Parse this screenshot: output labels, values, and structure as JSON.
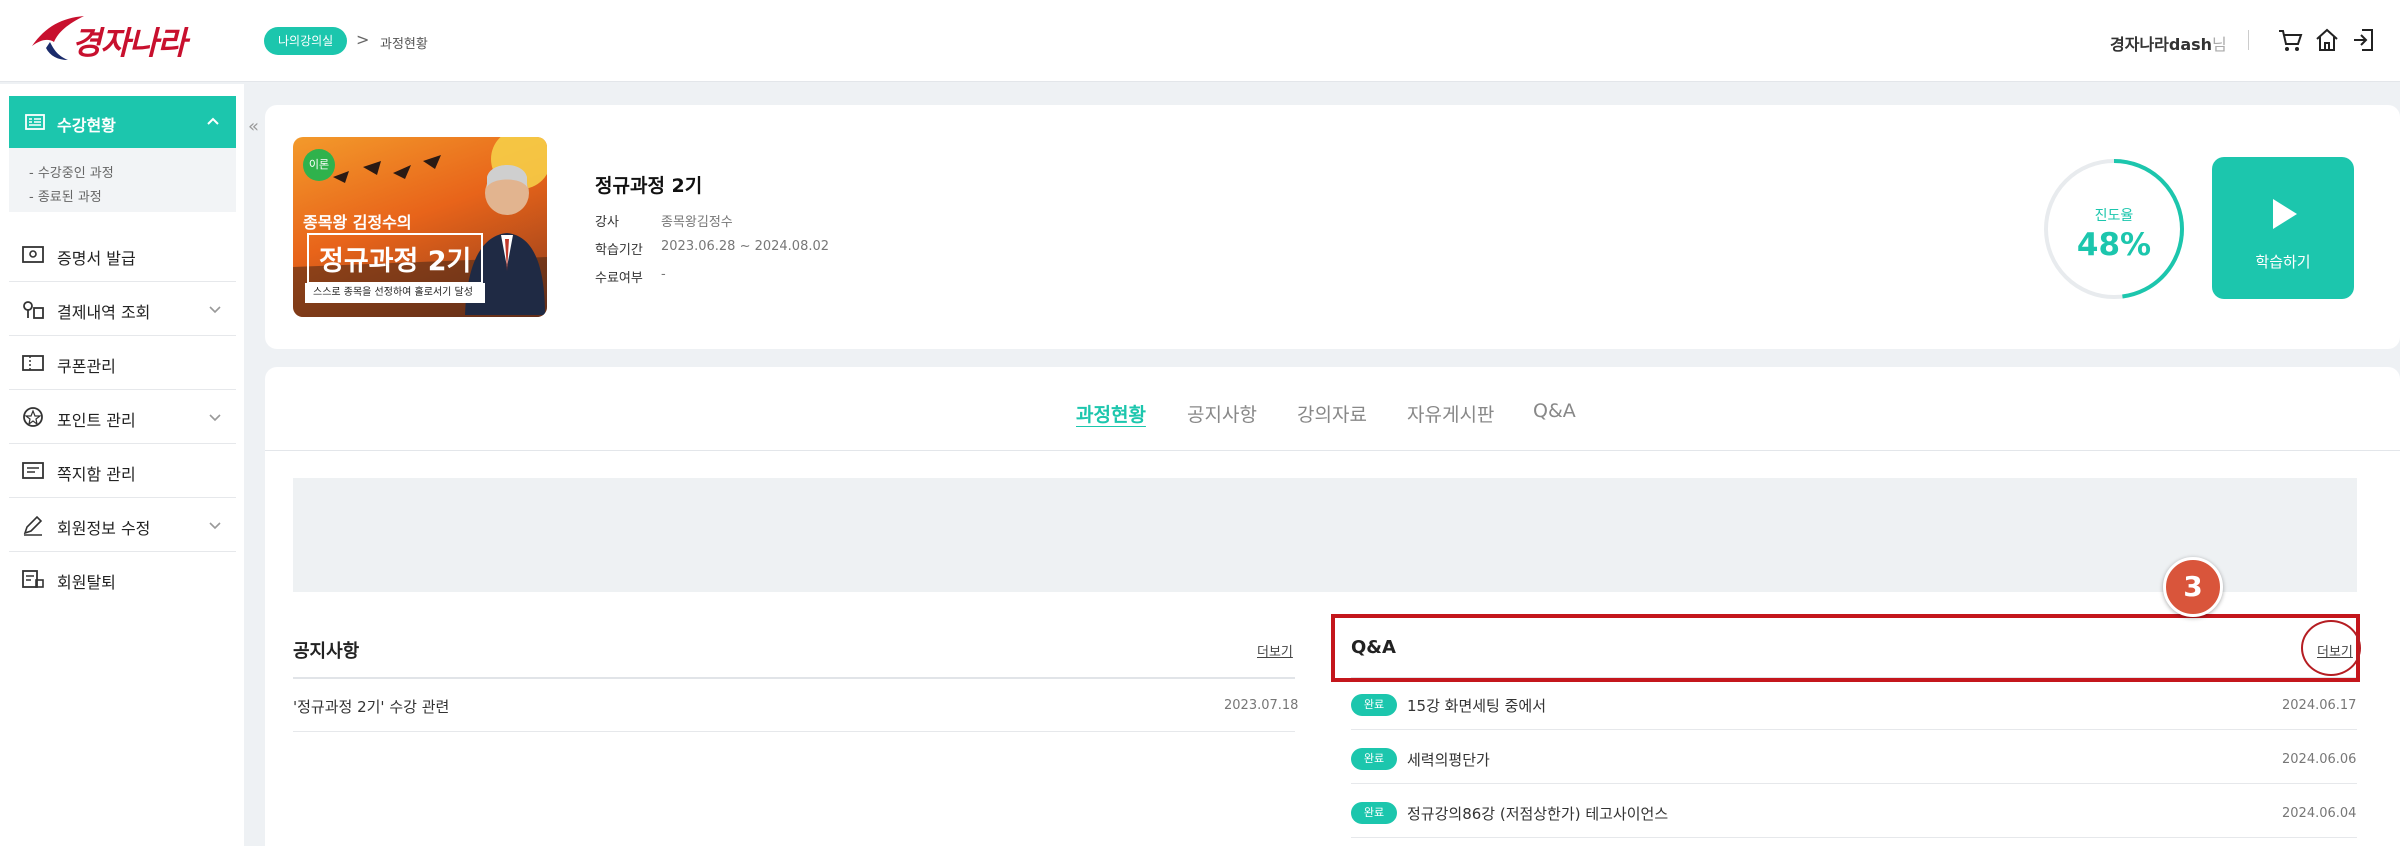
{
  "header": {
    "logo_text": "경자나라",
    "breadcrumb": {
      "home": "나의강의실",
      "separator": ">",
      "current": "과정현황"
    },
    "user": {
      "name": "경자나라dash",
      "suffix": "님"
    },
    "icons": [
      "cart-icon",
      "home-icon",
      "logout-icon"
    ]
  },
  "sidebar": {
    "collapse_glyph": "«",
    "active": {
      "label": "수강현황",
      "icon": "course-icon",
      "sub": [
        "- 수강중인 과정",
        "- 종료된 과정"
      ]
    },
    "items": [
      {
        "label": "증명서 발급",
        "icon": "certificate-icon",
        "has_children": false
      },
      {
        "label": "결제내역 조회",
        "icon": "payment-icon",
        "has_children": true
      },
      {
        "label": "쿠폰관리",
        "icon": "coupon-icon",
        "has_children": false
      },
      {
        "label": "포인트 관리",
        "icon": "point-icon",
        "has_children": true
      },
      {
        "label": "쪽지함 관리",
        "icon": "message-icon",
        "has_children": false
      },
      {
        "label": "회원정보 수정",
        "icon": "edit-icon",
        "has_children": true
      },
      {
        "label": "회원탈퇴",
        "icon": "withdraw-icon",
        "has_children": false
      }
    ]
  },
  "course": {
    "thumbnail": {
      "badge": "이론",
      "subtitle": "종목왕 김정수의",
      "title": "정규과정 2기",
      "strip": "스스로 종목을 선정하여 홀로서기 달성"
    },
    "title": "정규과정 2기",
    "meta": [
      {
        "label": "강사",
        "value": "종목왕김정수"
      },
      {
        "label": "학습기간",
        "value": "2023.06.28 ~ 2024.08.02"
      },
      {
        "label": "수료여부",
        "value": "-"
      }
    ],
    "progress": {
      "label": "진도율",
      "value_text": "48%",
      "fraction": 0.48
    },
    "study_button": "학습하기"
  },
  "tabs": [
    {
      "label": "과정현황",
      "active": true
    },
    {
      "label": "공지사항",
      "active": false
    },
    {
      "label": "강의자료",
      "active": false
    },
    {
      "label": "자유게시판",
      "active": false
    },
    {
      "label": "Q&A",
      "active": false
    }
  ],
  "notice": {
    "title": "공지사항",
    "more": "더보기",
    "rows": [
      {
        "text": "'정규과정 2기' 수강 관련",
        "date": "2023.07.18"
      }
    ]
  },
  "qna": {
    "title": "Q&A",
    "more": "더보기",
    "rows": [
      {
        "status": "완료",
        "text": "15강 화면세팅 중에서",
        "date": "2024.06.17"
      },
      {
        "status": "완료",
        "text": "세력의평단가",
        "date": "2024.06.06"
      },
      {
        "status": "완료",
        "text": "정규강의86강 (저점상한가) 테고사이언스",
        "date": "2024.06.04"
      }
    ]
  },
  "annotation": {
    "step": "3"
  },
  "colors": {
    "accent": "#1cc6ad",
    "brand_red": "#c8102e",
    "highlight": "#c4161c",
    "badge": "#d9553b"
  }
}
